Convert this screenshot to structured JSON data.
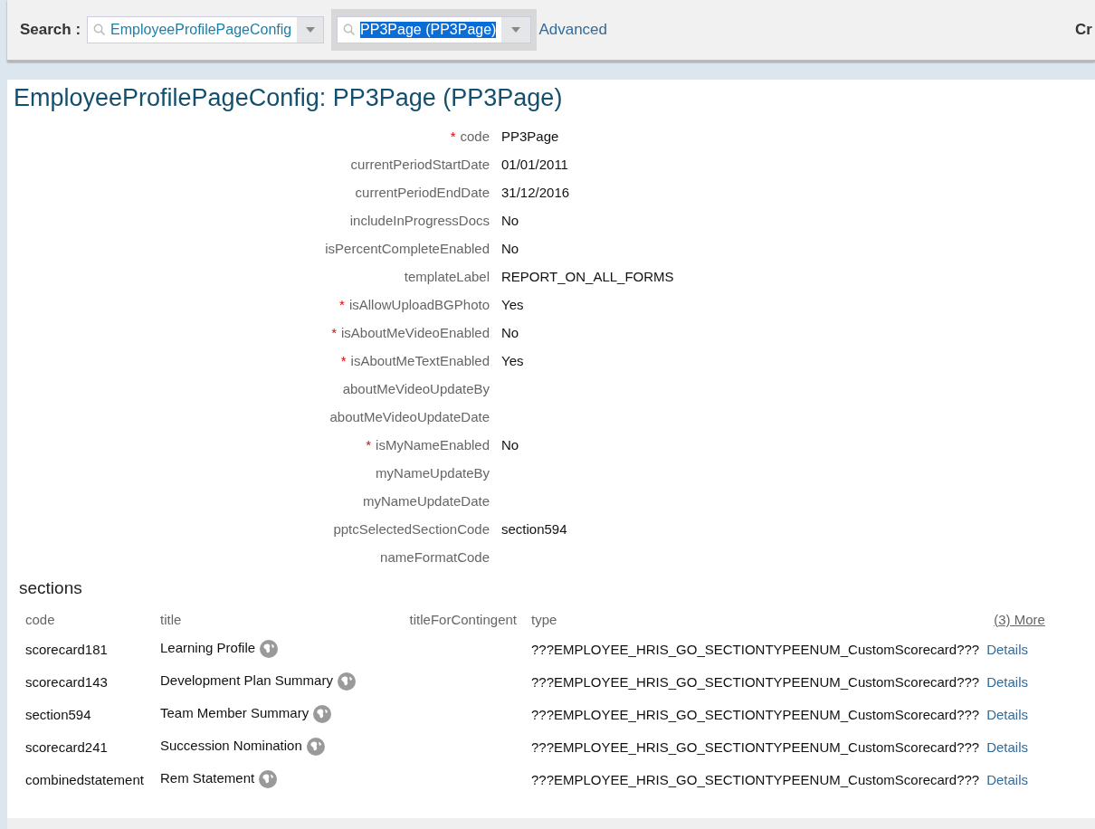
{
  "search_bar": {
    "label": "Search :",
    "object_type": {
      "value": "EmployeeProfilePageConfig"
    },
    "object_instance": {
      "value": "PP3Page (PP3Page)",
      "selected": true
    },
    "advanced_link": "Advanced",
    "right_label": "Cr"
  },
  "page_title": "EmployeeProfilePageConfig: PP3Page (PP3Page)",
  "fields": [
    {
      "label": "code",
      "required_mark": "*",
      "value": "PP3Page"
    },
    {
      "label": "currentPeriodStartDate",
      "value": "01/01/2011"
    },
    {
      "label": "currentPeriodEndDate",
      "value": "31/12/2016"
    },
    {
      "label": "includeInProgressDocs",
      "value": "No"
    },
    {
      "label": "isPercentCompleteEnabled",
      "value": "No"
    },
    {
      "label": "templateLabel",
      "value": "REPORT_ON_ALL_FORMS"
    },
    {
      "label": "isAllowUploadBGPhoto",
      "required_mark": "*",
      "value": "Yes"
    },
    {
      "label": "isAboutMeVideoEnabled",
      "required_mark": "*",
      "value": "No"
    },
    {
      "label": "isAboutMeTextEnabled",
      "required_mark": "*",
      "value": "Yes"
    },
    {
      "label": "aboutMeVideoUpdateBy"
    },
    {
      "label": "aboutMeVideoUpdateDate"
    },
    {
      "label": "isMyNameEnabled",
      "required_mark": "*",
      "value": "No"
    },
    {
      "label": "myNameUpdateBy"
    },
    {
      "label": "myNameUpdateDate"
    },
    {
      "label": "pptcSelectedSectionCode",
      "value": "section594"
    },
    {
      "label": "nameFormatCode"
    }
  ],
  "sections": {
    "heading": "sections",
    "columns": [
      "code",
      "title",
      "titleForContingent",
      "type"
    ],
    "more_link": "(3) More",
    "rows": [
      {
        "code": "scorecard181",
        "title": "Learning Profile",
        "type": "???EMPLOYEE_HRIS_GO_SECTIONTYPEENUM_CustomScorecard???",
        "link": "Details"
      },
      {
        "code": "scorecard143",
        "title": "Development Plan Summary",
        "type": "???EMPLOYEE_HRIS_GO_SECTIONTYPEENUM_CustomScorecard???",
        "link": "Details"
      },
      {
        "code": "section594",
        "title": "Team Member Summary",
        "type": "???EMPLOYEE_HRIS_GO_SECTIONTYPEENUM_CustomScorecard???",
        "link": "Details"
      },
      {
        "code": "scorecard241",
        "title": "Succession Nomination",
        "type": "???EMPLOYEE_HRIS_GO_SECTIONTYPEENUM_CustomScorecard???",
        "link": "Details"
      },
      {
        "code": "combinedstatement",
        "title": "Rem Statement",
        "type": "???EMPLOYEE_HRIS_GO_SECTIONTYPEENUM_CustomScorecard???",
        "link": "Details"
      }
    ]
  }
}
